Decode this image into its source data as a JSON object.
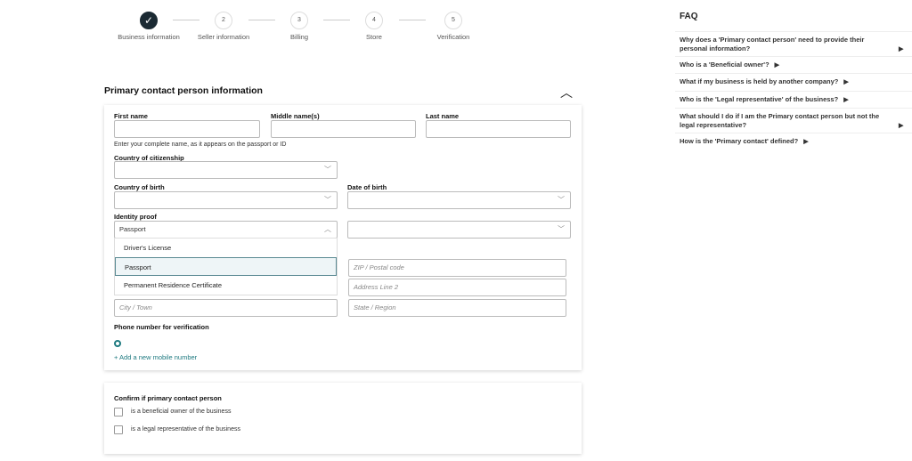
{
  "steps": [
    {
      "num": "✓",
      "label": "Business information"
    },
    {
      "num": "2",
      "label": "Seller information"
    },
    {
      "num": "3",
      "label": "Billing"
    },
    {
      "num": "4",
      "label": "Store"
    },
    {
      "num": "5",
      "label": "Verification"
    }
  ],
  "section_title": "Primary contact person information",
  "form": {
    "first_name": "First name",
    "middle_name": "Middle name(s)",
    "last_name": "Last name",
    "name_hint": "Enter your complete name, as it appears on the passport or ID",
    "citizenship": "Country of citizenship",
    "birth_country": "Country of birth",
    "dob": "Date of birth",
    "identity_proof": "Identity proof",
    "identity_value": "Passport",
    "options": [
      "Driver's License",
      "Passport",
      "Permanent Residence Certificate"
    ],
    "zip_ph": "ZIP / Postal code",
    "addr2_ph": "Address Line 2",
    "city_ph": "City / Town",
    "state_ph": "State / Region",
    "phone_label": "Phone number for verification",
    "add_mobile": "+ Add a new mobile number"
  },
  "confirm": {
    "title": "Confirm if primary contact person",
    "items": [
      "is a beneficial owner of the business",
      "is a legal representative of the business"
    ]
  },
  "faq": {
    "title": "FAQ",
    "items": [
      "Why does a 'Primary contact person' need to provide their personal information?",
      "Who is a 'Beneficial owner'?",
      "What if my business is held by another company?",
      "Who is the 'Legal representative' of the business?",
      "What should I do if I am the Primary contact person but not the legal representative?",
      "How is the 'Primary contact' defined?"
    ]
  }
}
